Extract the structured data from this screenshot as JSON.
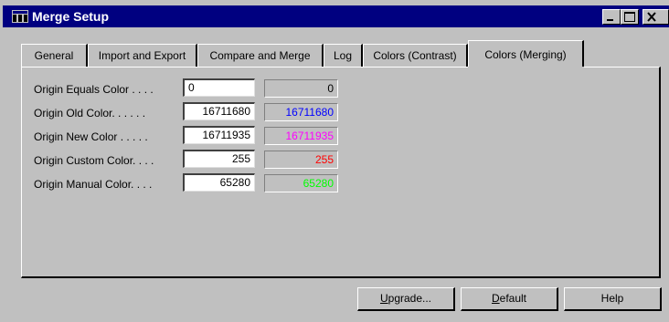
{
  "window": {
    "title": "Merge Setup",
    "icons": {
      "app": "app-icon",
      "minimize": "minimize-icon",
      "maximize": "maximize-icon",
      "close": "close-icon"
    }
  },
  "tabs": [
    {
      "label": "General"
    },
    {
      "label": "Import and Export"
    },
    {
      "label": "Compare and Merge"
    },
    {
      "label": "Log"
    },
    {
      "label": "Colors (Contrast)"
    },
    {
      "label": "Colors (Merging)",
      "active": true
    }
  ],
  "rows": [
    {
      "label": "Origin Equals Color . . . .",
      "value": "0",
      "preview": "0",
      "color": "#000000"
    },
    {
      "label": "Origin Old Color. . . . . .",
      "value": "16711680",
      "preview": "16711680",
      "color": "#0000ff"
    },
    {
      "label": "Origin New Color . . . . .",
      "value": "16711935",
      "preview": "16711935",
      "color": "#ff00ff"
    },
    {
      "label": "Origin Custom Color. . . .",
      "value": "255",
      "preview": "255",
      "color": "#ff0000"
    },
    {
      "label": "Origin Manual Color. . . .",
      "value": "65280",
      "preview": "65280",
      "color": "#00ff00"
    }
  ],
  "buttons": {
    "upgrade": "Upgrade...",
    "default": "Default",
    "help": "Help"
  }
}
